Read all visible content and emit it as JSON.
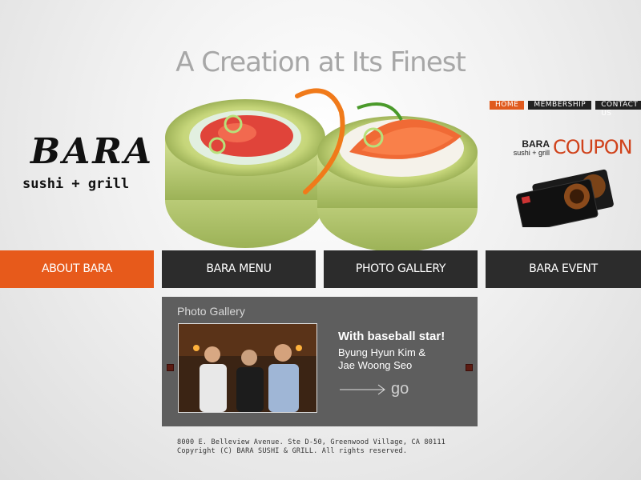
{
  "tagline": "A Creation at Its Finest",
  "top_nav": {
    "items": [
      "HOME",
      "MEMBERSHIP",
      "CONTACT US"
    ]
  },
  "logo": {
    "main": "BARA",
    "sub": "sushi + grill"
  },
  "coupon": {
    "brand": "BARA",
    "brand_sub": "sushi + grill",
    "label": "COUPON"
  },
  "main_nav": {
    "items": [
      "ABOUT BARA",
      "BARA MENU",
      "PHOTO GALLERY",
      "BARA EVENT"
    ]
  },
  "gallery": {
    "title": "Photo Gallery",
    "caption_title": "With baseball star!",
    "caption_line1": "Byung Hyun Kim &",
    "caption_line2": "Jae Woong Seo",
    "go_label": "go"
  },
  "footer": {
    "address": "8000 E. Belleview Avenue. Ste D-50, Greenwood Village, CA 80111",
    "copyright": "Copyright (C) BARA SUSHI & GRILL. All rights reserved."
  },
  "colors": {
    "accent_orange": "#e75a1b",
    "nav_dark": "#2c2c2c",
    "panel_gray": "#5e5e5e"
  }
}
